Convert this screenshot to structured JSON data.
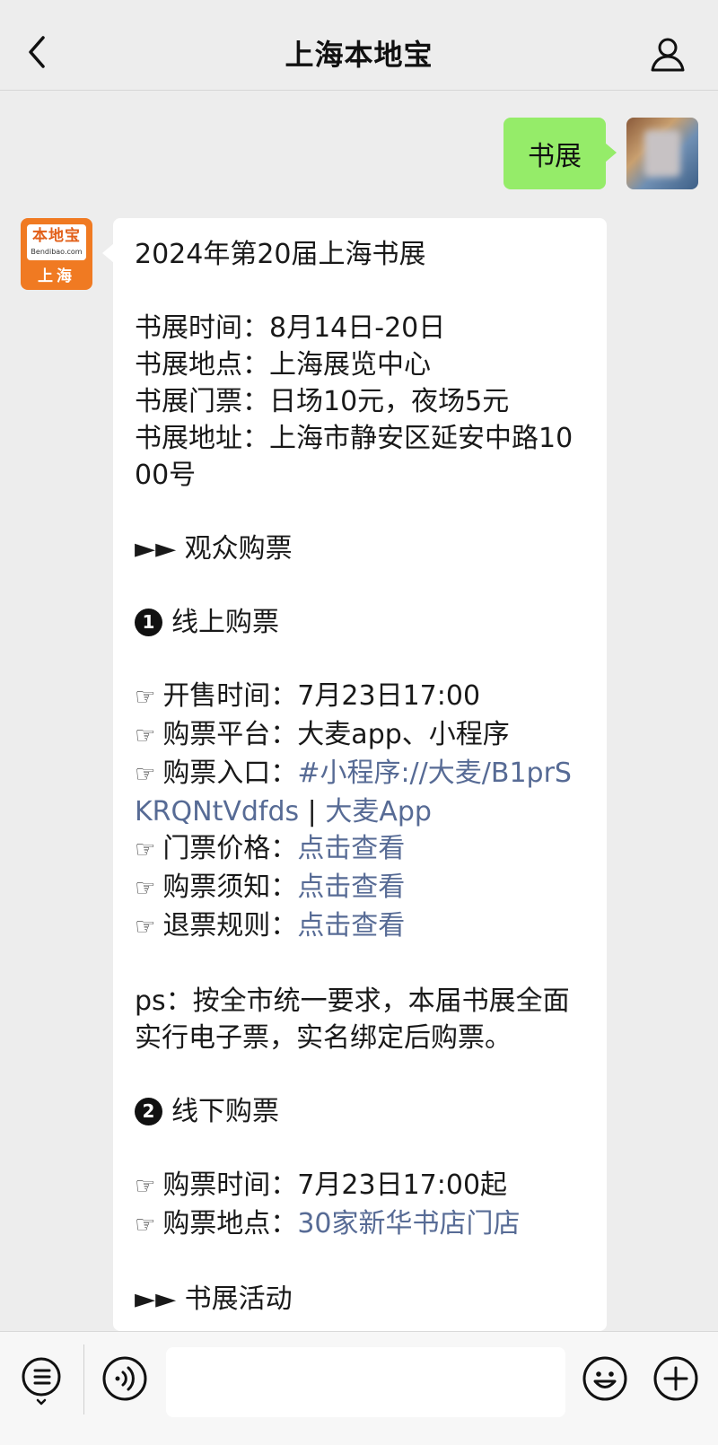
{
  "header": {
    "title": "上海本地宝",
    "back_icon": "chevron-left-icon",
    "profile_icon": "person-icon"
  },
  "user_message": {
    "text": "书展",
    "bubble_color": "#95ec69"
  },
  "official_account": {
    "avatar": {
      "logo_text": "本地宝",
      "logo_sub": "Bendibao.com",
      "city": "上海",
      "color": "#f07a22"
    }
  },
  "article": {
    "title": "2024年第20届上海书展",
    "info": [
      "书展时间：8月14日-20日",
      "书展地点：上海展览中心",
      "书展门票：日场10元，夜场5元",
      "书展地址：上海市静安区延安中路1000号"
    ],
    "section_buy": "►► 观众购票",
    "online": {
      "badge": "1",
      "title": "线上购票",
      "sale_time": "开售时间：7月23日17:00",
      "platform": "购票平台：大麦app、小程序",
      "entry_label": "购票入口：",
      "entry_link": "#小程序://大麦/B1prSKRQNtVdfds",
      "entry_sep": " | ",
      "entry_link2": "大麦App",
      "price_label": "门票价格：",
      "notice_label": "购票须知：",
      "refund_label": "退票规则：",
      "view_link": "点击查看"
    },
    "ps": "ps：按全市统一要求，本届书展全面实行电子票，实名绑定后购票。",
    "offline": {
      "badge": "2",
      "title": "线下购票",
      "time": "购票时间：7月23日17:00起",
      "place_label": "购票地点：",
      "place_link": "30家新华书店门店"
    },
    "section_events": "►► 书展活动",
    "link_color": "#576b95"
  },
  "bottom_bar": {
    "menu_icon": "list-menu-icon",
    "voice_icon": "voice-icon",
    "emoji_icon": "smile-icon",
    "plus_icon": "plus-icon",
    "input_value": ""
  }
}
